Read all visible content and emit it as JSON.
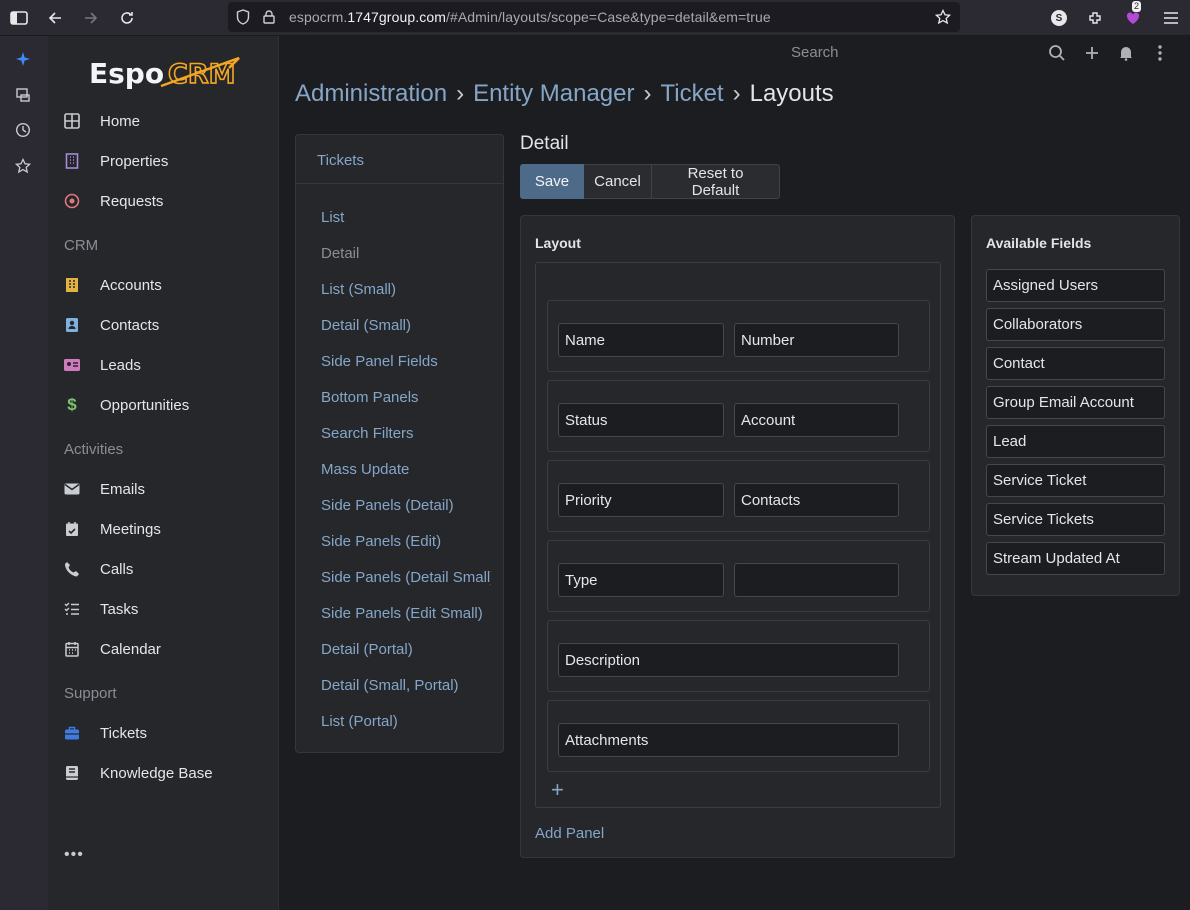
{
  "browser": {
    "url_prefix": "espocrm.",
    "url_domain": "1747group.com",
    "url_path": "/#Admin/layouts/scope=Case&type=detail&em=true",
    "extension_badge": "2",
    "account_initial": "S"
  },
  "logo": {
    "text_a": "Espo",
    "text_b": "CRM"
  },
  "sidebar": {
    "items": [
      {
        "label": "Home",
        "icon": "grid-icon"
      },
      {
        "label": "Properties",
        "icon": "building-icon"
      },
      {
        "label": "Requests",
        "icon": "target-icon"
      }
    ],
    "groups": [
      {
        "title": "CRM",
        "items": [
          {
            "label": "Accounts",
            "icon": "building-icon"
          },
          {
            "label": "Contacts",
            "icon": "contact-card-icon"
          },
          {
            "label": "Leads",
            "icon": "id-card-icon"
          },
          {
            "label": "Opportunities",
            "icon": "dollar-icon"
          }
        ]
      },
      {
        "title": "Activities",
        "items": [
          {
            "label": "Emails",
            "icon": "envelope-icon"
          },
          {
            "label": "Meetings",
            "icon": "calendar-check-icon"
          },
          {
            "label": "Calls",
            "icon": "phone-icon"
          },
          {
            "label": "Tasks",
            "icon": "tasks-icon"
          },
          {
            "label": "Calendar",
            "icon": "calendar-icon"
          }
        ]
      },
      {
        "title": "Support",
        "items": [
          {
            "label": "Tickets",
            "icon": "briefcase-icon"
          },
          {
            "label": "Knowledge Base",
            "icon": "book-icon"
          }
        ]
      }
    ],
    "more": "•••"
  },
  "navbar": {
    "search_placeholder": "Search"
  },
  "breadcrumb": {
    "items": [
      "Administration",
      "Entity Manager",
      "Ticket"
    ],
    "current": "Layouts",
    "separator": "›"
  },
  "layouts_panel": {
    "title": "Tickets",
    "links": [
      "List",
      "Detail",
      "List (Small)",
      "Detail (Small)",
      "Side Panel Fields",
      "Bottom Panels",
      "Search Filters",
      "Mass Update",
      "Side Panels (Detail)",
      "Side Panels (Edit)",
      "Side Panels (Detail Small)",
      "Side Panels (Edit Small)",
      "Detail (Portal)",
      "Detail (Small, Portal)",
      "List (Portal)"
    ],
    "active_index": 1
  },
  "editor": {
    "title": "Detail",
    "buttons": {
      "save": "Save",
      "cancel": "Cancel",
      "reset": "Reset to Default"
    },
    "layout_title": "Layout",
    "rows": [
      {
        "cells": [
          "Name",
          "Number"
        ]
      },
      {
        "cells": [
          "Status",
          "Account"
        ]
      },
      {
        "cells": [
          "Priority",
          "Contacts"
        ]
      },
      {
        "cells": [
          "Type",
          ""
        ]
      },
      {
        "full": "Description"
      },
      {
        "full": "Attachments"
      }
    ],
    "add_row": "+",
    "add_panel": "Add Panel"
  },
  "available_fields": {
    "title": "Available Fields",
    "items": [
      "Assigned Users",
      "Collaborators",
      "Contact",
      "Group Email Account",
      "Lead",
      "Service Ticket",
      "Service Tickets",
      "Stream Updated At"
    ]
  },
  "colors": {
    "link": "#85a6c7",
    "primary_button": "#4e6a89",
    "background": "#1c1d21",
    "panel": "#25272b"
  }
}
